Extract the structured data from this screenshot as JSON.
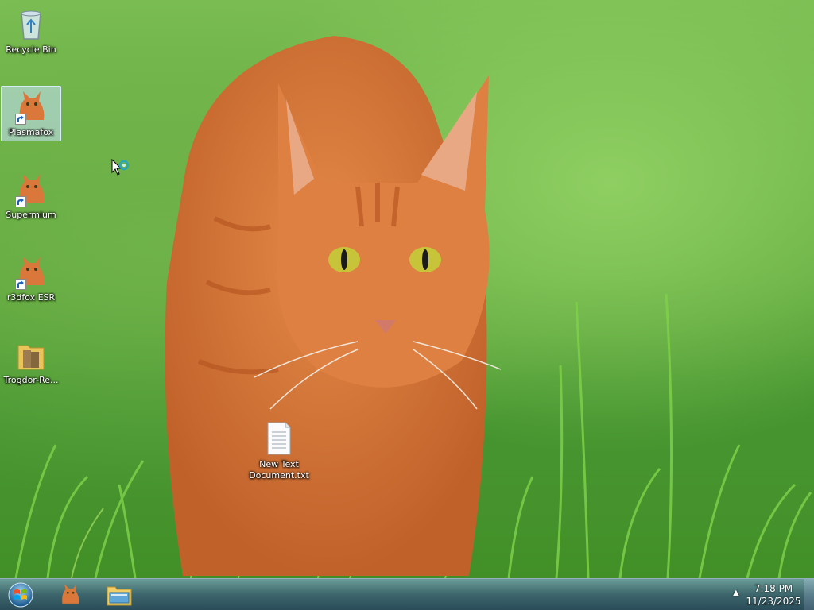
{
  "desktop": {
    "icons": [
      {
        "label": "Recycle Bin",
        "icon": "recycle-bin-icon",
        "shortcut": false
      },
      {
        "label": "Plasmafox",
        "icon": "cat-browser-icon",
        "shortcut": true,
        "selected": true
      },
      {
        "label": "Supermium",
        "icon": "cat-browser-icon",
        "shortcut": true
      },
      {
        "label": "r3dfox ESR",
        "icon": "cat-browser-icon",
        "shortcut": true
      },
      {
        "label": "Trogdor-Re...",
        "icon": "folder-icon",
        "shortcut": false
      }
    ],
    "file": {
      "label_line1": "New Text",
      "label_line2": "Document.txt",
      "icon": "text-file-icon"
    }
  },
  "taskbar": {
    "start": {
      "icon": "windows-orb-icon"
    },
    "pinned": [
      {
        "icon": "cat-browser-icon",
        "name": "browser"
      },
      {
        "icon": "folder-explorer-icon",
        "name": "explorer"
      }
    ],
    "tray_arrow": "▲",
    "clock": {
      "time": "7:18 PM",
      "date": "11/23/2025"
    }
  },
  "colors": {
    "grass": "#5fa83c",
    "cat": "#d9783a",
    "taskbar": "#3c5f78"
  }
}
